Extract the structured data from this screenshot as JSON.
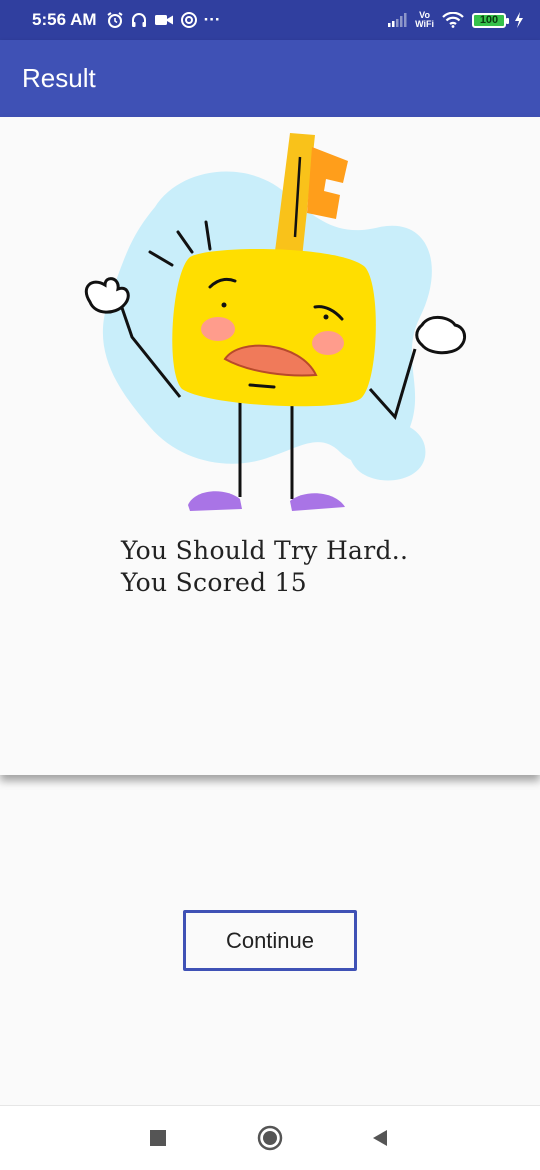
{
  "status_bar": {
    "time": "5:56 AM",
    "more_indicator": "···",
    "vowifi_top": "Vo",
    "vowifi_bottom": "WiFi",
    "battery_level": "100",
    "icons": [
      "alarm-icon",
      "headphones-icon",
      "video-camera-icon",
      "sync-icon",
      "signal-icon",
      "wifi-icon",
      "battery-icon",
      "charging-icon"
    ]
  },
  "app_bar": {
    "title": "Result",
    "color": "#3f51b5",
    "status_color": "#303f9f"
  },
  "result": {
    "message_line1": "You Should Try Hard..",
    "message_line2": "You Scored 15",
    "illustration": "sad-key-character-illustration"
  },
  "actions": {
    "continue_label": "Continue",
    "accent": "#3f51b5"
  },
  "navigation": {
    "icons": [
      "recent-apps-icon",
      "home-icon",
      "back-icon"
    ]
  }
}
